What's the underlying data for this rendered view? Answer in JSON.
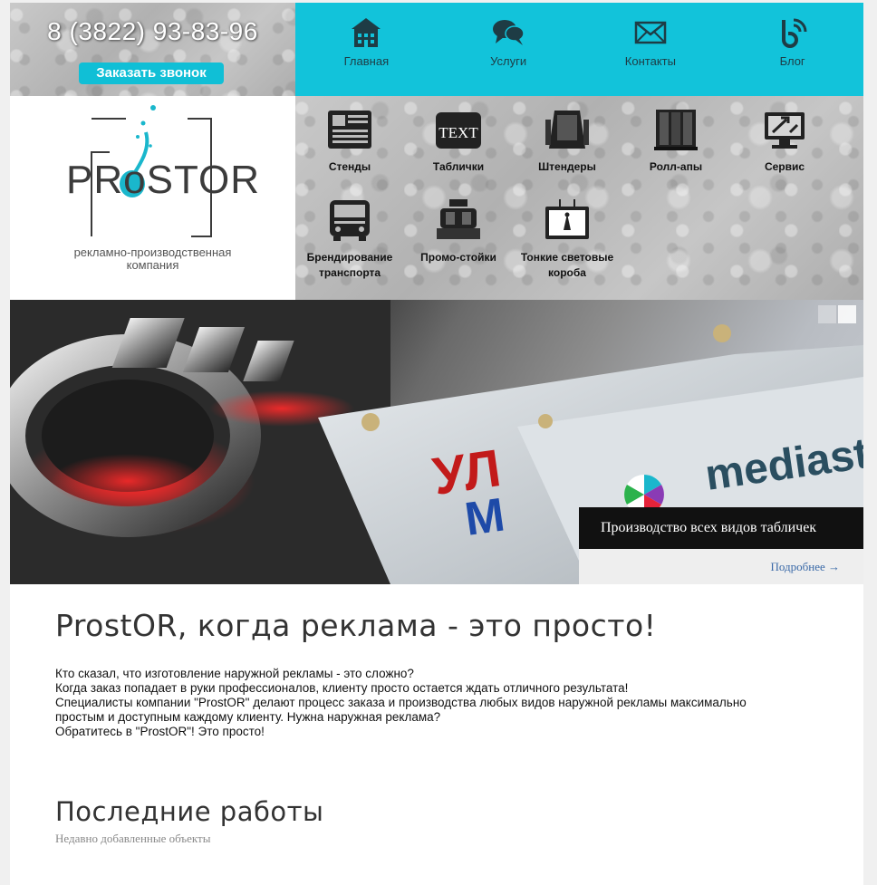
{
  "header": {
    "phone": "8 (3822) 93-83-96",
    "callback_label": "Заказать звонок"
  },
  "topnav": {
    "items": [
      {
        "label": "Главная",
        "icon": "home-icon"
      },
      {
        "label": "Услуги",
        "icon": "speech-bubbles-icon"
      },
      {
        "label": "Контакты",
        "icon": "envelope-icon"
      },
      {
        "label": "Блог",
        "icon": "blog-rss-icon"
      }
    ]
  },
  "logo": {
    "name": "PRoSTOR",
    "subtitle_line1": "рекламно-производственная",
    "subtitle_line2": "компания"
  },
  "services": {
    "items": [
      {
        "line1": "Стенды",
        "line2": "",
        "icon": "newspaper-stand-icon"
      },
      {
        "line1": "Таблички",
        "line2": "",
        "icon": "text-sign-icon"
      },
      {
        "line1": "Штендеры",
        "line2": "",
        "icon": "sandwich-board-icon"
      },
      {
        "line1": "Ролл-апы",
        "line2": "",
        "icon": "roll-up-icon"
      },
      {
        "line1": "Сервис",
        "line2": "",
        "icon": "service-tools-icon"
      },
      {
        "line1": "Брендирование",
        "line2": "транспорта",
        "icon": "bus-icon"
      },
      {
        "line1": "Промо-стойки",
        "line2": "",
        "icon": "promo-stand-icon"
      },
      {
        "line1": "Тонкие световые",
        "line2": "короба",
        "icon": "lightbox-icon"
      }
    ]
  },
  "banner": {
    "caption_title": "Производство всех видов табличек",
    "more_label": "Подробнее →",
    "sign_text_1": "mediast",
    "sign_text_2": "УЛ",
    "sign_text_3": "М"
  },
  "content": {
    "headline": "ProstOR, когда реклама - это просто!",
    "paragraph": [
      "Кто сказал, что изготовление наружной рекламы - это сложно?",
      "Когда заказ попадает в руки профессионалов, клиенту просто остается ждать отличного результата!",
      "Специалисты компании \"ProstOR\" делают процесс заказа и производства любых видов наружной рекламы максимально",
      "простым и доступным каждому клиенту. Нужна наружная реклама?",
      "Обратитесь в \"ProstOR\"! Это просто!"
    ],
    "works_title": "Последние работы",
    "works_subtitle": "Недавно добавленные объекты"
  },
  "colors": {
    "accent": "#12c3da",
    "button": "#10bfd6",
    "link": "#3b6aa8"
  }
}
